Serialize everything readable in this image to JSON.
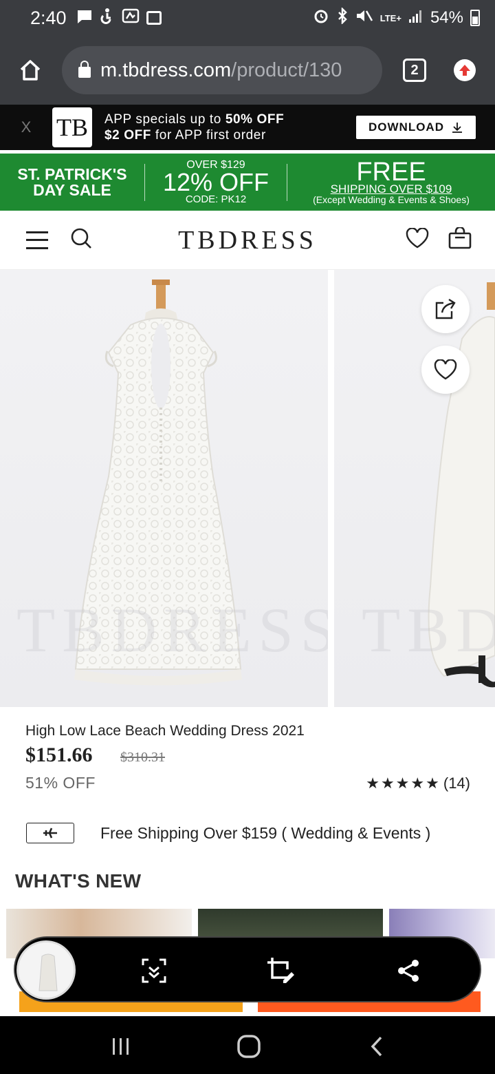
{
  "status": {
    "time": "2:40",
    "network": "LTE+",
    "battery": "54%"
  },
  "browser": {
    "url_host": "m.tbdress.com",
    "url_path": "/product/130",
    "tab_count": "2"
  },
  "app_banner": {
    "close": "X",
    "logo": "TB",
    "line1_pre": "APP specials up to ",
    "line1_bold": "50% OFF",
    "line2_bold": "$2 OFF",
    "line2_post": " for APP first order",
    "download": "DOWNLOAD"
  },
  "promo": {
    "sale_line1": "ST. PATRICK'S",
    "sale_line2": "DAY SALE",
    "over": "OVER $129",
    "pct": "12% OFF",
    "code": "CODE: PK12",
    "free": "FREE",
    "ship": "SHIPPING OVER $109",
    "except": "(Except Wedding & Events & Shoes)"
  },
  "header": {
    "brand": "TBDRESS"
  },
  "gallery": {
    "watermark": "TBDRESS"
  },
  "product": {
    "title": "High Low Lace Beach Wedding Dress 2021",
    "price": "$151.66",
    "original_price": "$310.31",
    "discount": "51% OFF",
    "rating_stars": 5,
    "review_count": "(14)"
  },
  "shipping": {
    "text": "Free Shipping Over $159 ( Wedding & Events )"
  },
  "whats_new": {
    "title": "WHAT'S NEW"
  },
  "colors": {
    "promo_green": "#1e8a31",
    "cta_left": "#f5a21b",
    "cta_right": "#ff5a1f",
    "upgrade_red": "#e53935"
  },
  "icons": [
    "home-icon",
    "lock-icon",
    "upgrade-icon",
    "download-icon",
    "menu-icon",
    "search-icon",
    "heart-icon",
    "bag-icon",
    "share-icon",
    "plane-icon",
    "scroll-capture-icon",
    "crop-edit-icon",
    "share-node-icon",
    "recents-icon",
    "home-nav-icon",
    "back-icon"
  ]
}
